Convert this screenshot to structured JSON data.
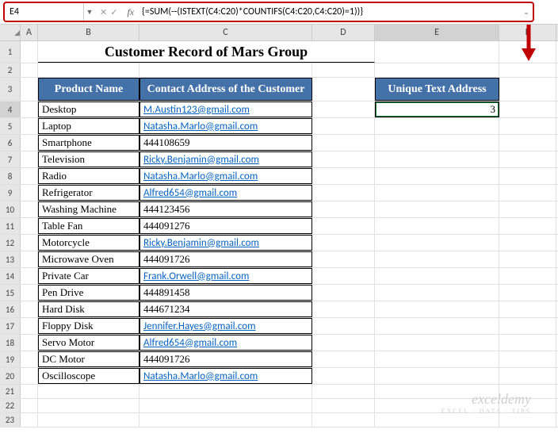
{
  "name_box": "E4",
  "formula": "{=SUM(--(ISTEXT(C4:C20)*COUNTIFS(C4:C20,C4:C20)=1))}",
  "columns": [
    "A",
    "B",
    "C",
    "D",
    "E",
    "F"
  ],
  "title": "Customer Record of Mars Group",
  "table_header": {
    "product": "Product Name",
    "contact": "Contact Address of the Customer"
  },
  "unique_header": "Unique Text Address",
  "unique_value": "3",
  "rows": [
    {
      "n": 4,
      "product": "Desktop",
      "contact": "M.Austin123@gmail.com",
      "link": true
    },
    {
      "n": 5,
      "product": "Laptop",
      "contact": "Natasha.Marlo@gmail.com",
      "link": true
    },
    {
      "n": 6,
      "product": "Smartphone",
      "contact": "444108659",
      "link": false
    },
    {
      "n": 7,
      "product": "Television",
      "contact": "Ricky.Benjamin@gmail.com",
      "link": true
    },
    {
      "n": 8,
      "product": "Radio",
      "contact": "Natasha.Marlo@gmail.com",
      "link": true
    },
    {
      "n": 9,
      "product": "Refrigerator",
      "contact": "Alfred654@gmail.com",
      "link": true
    },
    {
      "n": 10,
      "product": "Washing Machine",
      "contact": "444123456",
      "link": false
    },
    {
      "n": 11,
      "product": "Table Fan",
      "contact": "444091276",
      "link": false
    },
    {
      "n": 12,
      "product": "Motorcycle",
      "contact": "Ricky.Benjamin@gmail.com",
      "link": true
    },
    {
      "n": 13,
      "product": "Microwave Oven",
      "contact": "444091726",
      "link": false
    },
    {
      "n": 14,
      "product": "Private Car",
      "contact": "Frank.Orwell@gmail.com",
      "link": true
    },
    {
      "n": 15,
      "product": "Pen Drive",
      "contact": "444891458",
      "link": false
    },
    {
      "n": 16,
      "product": "Hard Disk",
      "contact": "444671234",
      "link": false
    },
    {
      "n": 17,
      "product": "Floppy Disk",
      "contact": "Jennifer.Hayes@gmail.com",
      "link": true
    },
    {
      "n": 18,
      "product": "Servo Motor",
      "contact": "Alfred654@gmail.com",
      "link": true
    },
    {
      "n": 19,
      "product": "DC Motor",
      "contact": "444091726",
      "link": false
    },
    {
      "n": 20,
      "product": "Oscilloscope",
      "contact": "Natasha.Marlo@gmail.com",
      "link": true
    }
  ],
  "blank_rows": [
    21,
    22,
    23
  ],
  "watermark": {
    "brand": "exceldemy",
    "tagline": "EXCEL · DATA · TIPS"
  }
}
